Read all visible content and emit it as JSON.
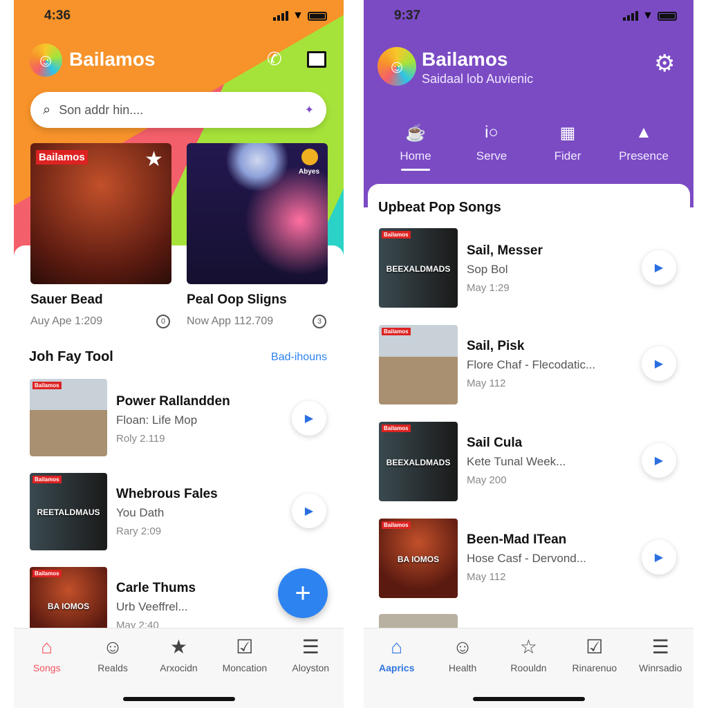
{
  "left": {
    "status": {
      "time": "4:36"
    },
    "app_title": "Bailamos",
    "search": {
      "placeholder": "Son addr hin...."
    },
    "featured": [
      {
        "title": "Sauer Bead",
        "subtitle": "Auy Ape 1:209",
        "badge": "0",
        "art_label": "Bailamos"
      },
      {
        "title": "Peal Oop Sligns",
        "subtitle": "Now App 112.709",
        "badge": "3",
        "art_label": "Abyes"
      }
    ],
    "section": {
      "title": "Joh Fay Tool",
      "link": "Bad-ihouns"
    },
    "songs": [
      {
        "title": "Power Rallandden",
        "subtitle": "Floan: Life Mop",
        "meta": "Roly 2.119",
        "art_label": ""
      },
      {
        "title": "Whebrous Fales",
        "subtitle": "You Dath",
        "meta": "Rary 2:09",
        "art_label": "REETALDMAUS"
      },
      {
        "title": "Carle Thums",
        "subtitle": "Urb Veeffrel...",
        "meta": "May 2:40",
        "art_label": "BA IOMOS"
      }
    ],
    "fab": "+",
    "tabs": [
      {
        "label": "Songs",
        "icon": "home-icon",
        "active": true
      },
      {
        "label": "Realds",
        "icon": "person-icon"
      },
      {
        "label": "Arxocidn",
        "icon": "star-icon"
      },
      {
        "label": "Moncation",
        "icon": "checkbox-icon"
      },
      {
        "label": "Aloyston",
        "icon": "menu-icon"
      }
    ],
    "accent": "#f2525e"
  },
  "right": {
    "status": {
      "time": "9:37"
    },
    "app_title": "Bailamos",
    "subtitle": "Saidaal lob Auvienic",
    "top_tabs": [
      {
        "label": "Home",
        "icon": "trophy-icon",
        "active": true
      },
      {
        "label": "Serve",
        "icon": "io-icon"
      },
      {
        "label": "Fider",
        "icon": "grid-icon"
      },
      {
        "label": "Presence",
        "icon": "compass-icon"
      }
    ],
    "section": {
      "title": "Upbeat Pop Songs"
    },
    "songs": [
      {
        "title": "Sail, Messer",
        "subtitle": "Sop Bol",
        "meta": "May 1:29",
        "art_label": "BEEXALDMADS"
      },
      {
        "title": "Sail, Pisk",
        "subtitle": "Flore Chaf - Flecodatic...",
        "meta": "May 112",
        "art_label": ""
      },
      {
        "title": "Sail Cula",
        "subtitle": "Kete Tunal Week...",
        "meta": "May 200",
        "art_label": "BEEXALDMADS"
      },
      {
        "title": "Been-Mad ITean",
        "subtitle": "Hose Casf - Dervond...",
        "meta": "May 112",
        "art_label": "BA IOMOS"
      }
    ],
    "tabs": [
      {
        "label": "Aaprics",
        "icon": "home-icon",
        "active": true
      },
      {
        "label": "Health",
        "icon": "person-icon"
      },
      {
        "label": "Roouldn",
        "icon": "star-outline-icon"
      },
      {
        "label": "Rinarenuo",
        "icon": "checkbox-icon"
      },
      {
        "label": "Winrsadio",
        "icon": "menu-icon"
      }
    ],
    "accent": "#2d74e0",
    "header_color": "#7b4bc4"
  }
}
